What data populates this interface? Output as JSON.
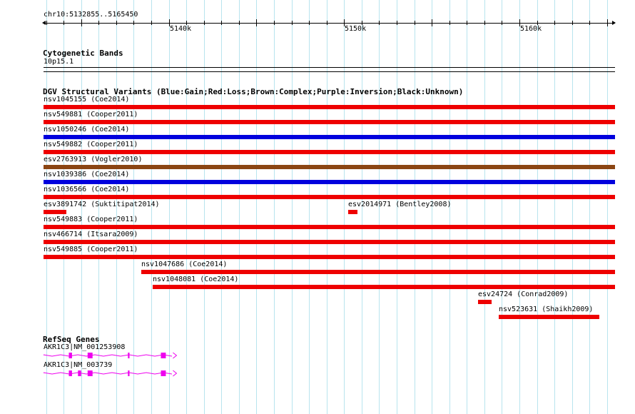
{
  "ruler": {
    "position_label": "chr10:5132855..5165450",
    "start": 5132855,
    "end": 5165450,
    "ticks": [
      {
        "pos": 5140000,
        "label": "5140k"
      },
      {
        "pos": 5150000,
        "label": "5150k"
      },
      {
        "pos": 5160000,
        "label": "5160k"
      }
    ]
  },
  "cytobands": {
    "title": "Cytogenetic Bands",
    "band": "10p15.1"
  },
  "dgv": {
    "title": "DGV Structural Variants (Blue:Gain;Red:Loss;Brown:Complex;Purple:Inversion;Black:Unknown)",
    "colors": {
      "loss": "#ee0000",
      "gain": "#0000dd",
      "complex": "#8b4513"
    },
    "variants": [
      {
        "label": "nsv1045155 (Coe2014)",
        "type": "loss",
        "start": 5132855,
        "end": 5165450,
        "row": 0
      },
      {
        "label": "nsv549881 (Cooper2011)",
        "type": "loss",
        "start": 5132855,
        "end": 5165450,
        "row": 1
      },
      {
        "label": "nsv1050246 (Coe2014)",
        "type": "gain",
        "start": 5132855,
        "end": 5165450,
        "row": 2
      },
      {
        "label": "nsv549882 (Cooper2011)",
        "type": "loss",
        "start": 5132855,
        "end": 5165450,
        "row": 3
      },
      {
        "label": "esv2763913 (Vogler2010)",
        "type": "complex",
        "start": 5132855,
        "end": 5165450,
        "row": 4
      },
      {
        "label": "nsv1039386 (Coe2014)",
        "type": "gain",
        "start": 5132855,
        "end": 5165450,
        "row": 5
      },
      {
        "label": "nsv1036566 (Coe2014)",
        "type": "loss",
        "start": 5132855,
        "end": 5165450,
        "row": 6
      },
      {
        "label": "esv3891742 (Suktitipat2014)",
        "type": "loss",
        "start": 5132855,
        "end": 5134150,
        "row": 7
      },
      {
        "label": "esv2014971 (Bentley2008)",
        "type": "loss",
        "start": 5150250,
        "end": 5150780,
        "row": 7
      },
      {
        "label": "nsv549883 (Cooper2011)",
        "type": "loss",
        "start": 5132855,
        "end": 5165450,
        "row": 8
      },
      {
        "label": "nsv466714 (Itsara2009)",
        "type": "loss",
        "start": 5132855,
        "end": 5165450,
        "row": 9
      },
      {
        "label": "nsv549885 (Cooper2011)",
        "type": "loss",
        "start": 5132855,
        "end": 5165450,
        "row": 10
      },
      {
        "label": "nsv1047686 (Coe2014)",
        "type": "loss",
        "start": 5138420,
        "end": 5165450,
        "row": 11
      },
      {
        "label": "nsv1048081 (Coe2014)",
        "type": "loss",
        "start": 5139070,
        "end": 5165450,
        "row": 12
      },
      {
        "label": "esv24724 (Conrad2009)",
        "type": "loss",
        "start": 5157650,
        "end": 5158430,
        "row": 13
      },
      {
        "label": "nsv523631 (Shaikh2009)",
        "type": "loss",
        "start": 5158800,
        "end": 5164520,
        "row": 14
      }
    ]
  },
  "refseq": {
    "title": "RefSeq Genes",
    "color": "#ee00ee",
    "genes": [
      {
        "label": "AKR1C3|NM_001253908",
        "start": 5132855,
        "end": 5140400,
        "exons": [
          [
            5134300,
            5134480
          ],
          [
            5135370,
            5135650
          ],
          [
            5137670,
            5137760
          ],
          [
            5139550,
            5139830
          ]
        ]
      },
      {
        "label": "AKR1C3|NM_003739",
        "start": 5132855,
        "end": 5140400,
        "exons": [
          [
            5134300,
            5134480
          ],
          [
            5134820,
            5135000
          ],
          [
            5135370,
            5135650
          ],
          [
            5137670,
            5137760
          ],
          [
            5139550,
            5139830
          ]
        ]
      }
    ]
  }
}
